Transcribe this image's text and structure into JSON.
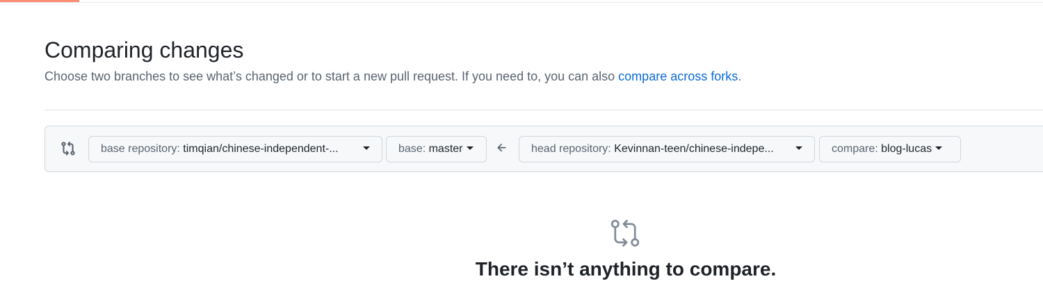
{
  "header": {
    "title": "Comparing changes",
    "subtitle_text": "Choose two branches to see what’s changed or to start a new pull request. If you need to, you can also ",
    "subtitle_link": "compare across forks",
    "subtitle_end": "."
  },
  "range": {
    "base_repo_label": "base repository:",
    "base_repo_value": "timqian/chinese-independent-...",
    "base_label": "base:",
    "base_value": "master",
    "head_repo_label": "head repository:",
    "head_repo_value": "Kevinnan-teen/chinese-indepe...",
    "compare_label": "compare:",
    "compare_value": "blog-lucas"
  },
  "blankslate": {
    "title": "There isn’t anything to compare."
  },
  "colors": {
    "accent": "#0969da",
    "progress": "#fd8c73"
  },
  "icons": {
    "range_icon": "git-compare-icon",
    "arrow": "arrow-left-icon",
    "empty": "git-compare-icon"
  }
}
